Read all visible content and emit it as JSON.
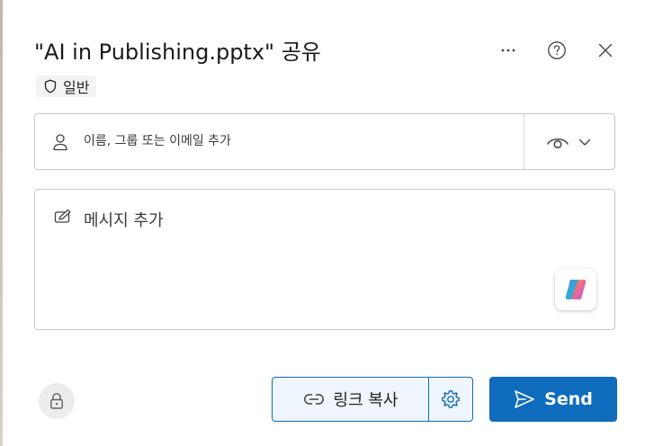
{
  "dialog": {
    "title": "\"AI in Publishing.pptx\" 공유",
    "sensitivity_label": "일반"
  },
  "top_actions": {
    "more_icon": "more-horizontal-icon",
    "help_icon": "help-circle-icon",
    "close_icon": "close-icon"
  },
  "people_input": {
    "placeholder": "이름, 그룹 또는 이메일 추가",
    "value": ""
  },
  "permission": {
    "icon": "eye-icon",
    "dropdown_icon": "chevron-down-icon"
  },
  "message": {
    "placeholder": "메시지 추가",
    "value": ""
  },
  "footer": {
    "copy_link_label": "링크 복사",
    "send_label": "Send"
  },
  "colors": {
    "accent": "#0f6cbd",
    "accent_light": "#eef5fc",
    "border": "#c9c9c9"
  }
}
